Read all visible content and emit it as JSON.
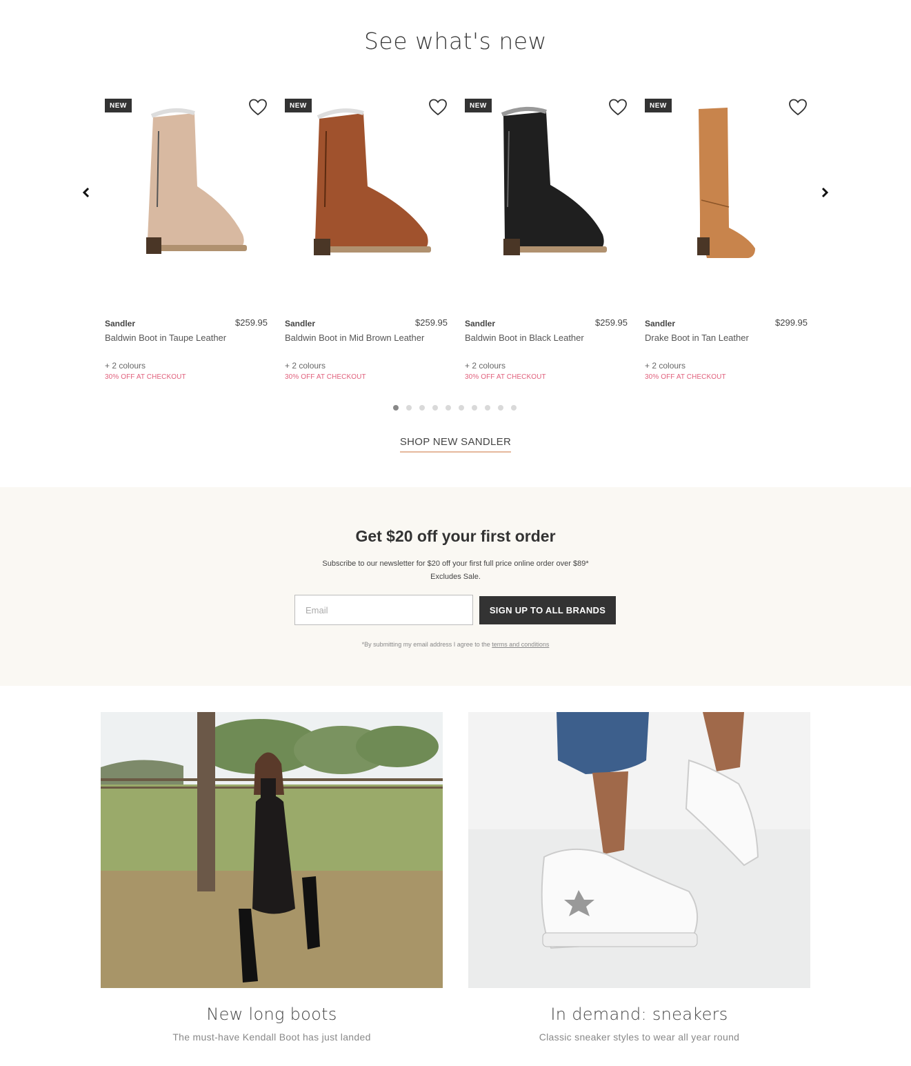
{
  "section": {
    "title": "See what's new",
    "shop_link": "SHOP NEW SANDLER"
  },
  "products": [
    {
      "badge": "NEW",
      "brand": "Sandler",
      "price": "$259.95",
      "name": "Baldwin Boot in Taupe Leather",
      "colours": "+ 2 colours",
      "promo": "30% OFF AT CHECKOUT",
      "color": "#d8b9a1"
    },
    {
      "badge": "NEW",
      "brand": "Sandler",
      "price": "$259.95",
      "name": "Baldwin Boot in Mid Brown Leather",
      "colours": "+ 2 colours",
      "promo": "30% OFF AT CHECKOUT",
      "color": "#a0522d"
    },
    {
      "badge": "NEW",
      "brand": "Sandler",
      "price": "$259.95",
      "name": "Baldwin Boot in Black Leather",
      "colours": "+ 2 colours",
      "promo": "30% OFF AT CHECKOUT",
      "color": "#1f1f1f"
    },
    {
      "badge": "NEW",
      "brand": "Sandler",
      "price": "$299.95",
      "name": "Drake Boot in Tan Leather",
      "colours": "+ 2 colours",
      "promo": "30% OFF AT CHECKOUT",
      "color": "#c8844c"
    }
  ],
  "carousel": {
    "dot_count": 10,
    "active_index": 0
  },
  "newsletter": {
    "title": "Get $20 off your first order",
    "text_line1": "Subscribe to our newsletter for $20 off your first full price online order over $89*",
    "text_line2": "Excludes Sale.",
    "email_placeholder": "Email",
    "button": "SIGN UP TO ALL BRANDS",
    "terms_prefix": "*By submitting my email address I agree to the",
    "terms_link": "terms and conditions"
  },
  "promos": [
    {
      "title": "New long boots",
      "subtitle": "The must-have Kendall Boot has just landed"
    },
    {
      "title": "In demand: sneakers",
      "subtitle": "Classic sneaker styles to wear all year round"
    }
  ]
}
